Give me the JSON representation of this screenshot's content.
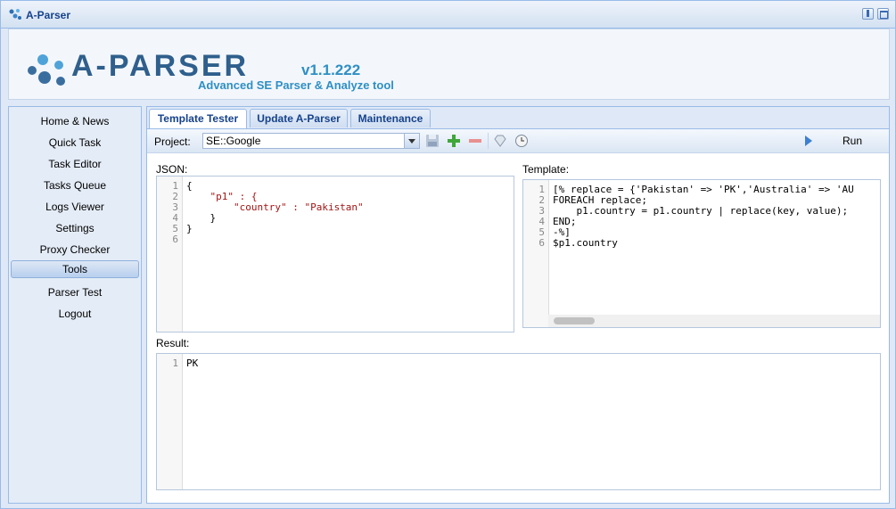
{
  "window": {
    "title": "A-Parser"
  },
  "header": {
    "version": "v1.1.222",
    "tagline": "Advanced SE Parser & Analyze tool",
    "logo_text": "A-PARSER"
  },
  "sidebar": {
    "items": [
      {
        "label": "Home & News",
        "active": false
      },
      {
        "label": "Quick Task",
        "active": false
      },
      {
        "label": "Task Editor",
        "active": false
      },
      {
        "label": "Tasks Queue",
        "active": false
      },
      {
        "label": "Logs Viewer",
        "active": false
      },
      {
        "label": "Settings",
        "active": false
      },
      {
        "label": "Proxy Checker",
        "active": false
      },
      {
        "label": "Tools",
        "active": true
      },
      {
        "label": "Parser Test",
        "active": false
      },
      {
        "label": "Logout",
        "active": false
      }
    ]
  },
  "tabs": [
    {
      "label": "Template Tester",
      "active": true
    },
    {
      "label": "Update A-Parser",
      "active": false
    },
    {
      "label": "Maintenance",
      "active": false
    }
  ],
  "toolbar": {
    "project_label": "Project:",
    "project_value": "SE::Google",
    "run_label": "Run"
  },
  "json_panel": {
    "label": "JSON:",
    "line_numbers": [
      "1",
      "2",
      "3",
      "4",
      "5",
      "6"
    ],
    "lines": [
      "{",
      "    \"p1\" : {",
      "        \"country\" : \"Pakistan\"",
      "    }",
      "}",
      ""
    ]
  },
  "template_panel": {
    "label": "Template:",
    "line_numbers": [
      "1",
      "2",
      "3",
      "4",
      "5",
      "6"
    ],
    "lines": [
      "[% replace = {'Pakistan' => 'PK','Australia' => 'AU",
      "FOREACH replace;",
      "    p1.country = p1.country | replace(key, value);",
      "END;",
      "-%]",
      "$p1.country"
    ]
  },
  "result_panel": {
    "label": "Result:",
    "line_numbers": [
      "1"
    ],
    "lines": [
      "PK"
    ]
  },
  "colors": {
    "accent": "#15428b",
    "border": "#99bbe8",
    "string": "#a31515"
  }
}
